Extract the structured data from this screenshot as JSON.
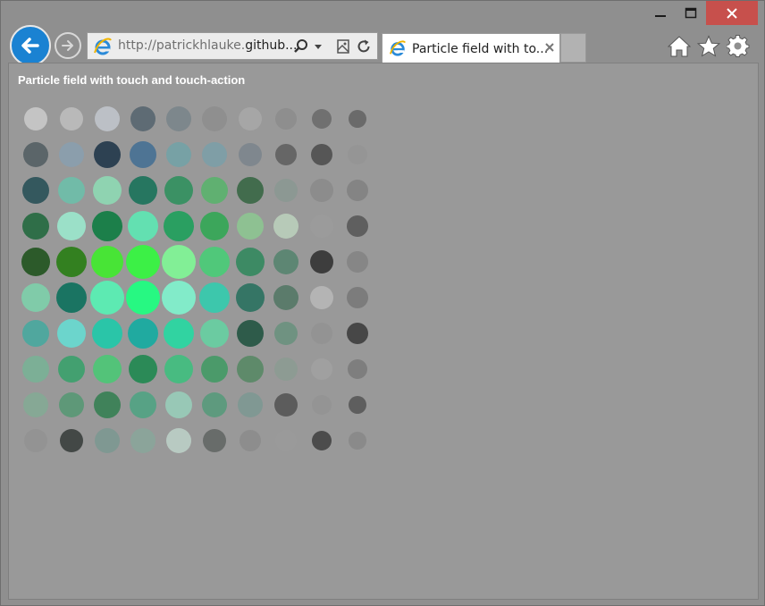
{
  "browser": {
    "address": {
      "url_prefix": "http://patrickhlauke.",
      "url_domain": "github..."
    },
    "tab": {
      "label": "Particle field with to..."
    }
  },
  "page": {
    "title": "Particle field with touch and touch-action"
  },
  "icons": [
    "back-arrow-icon",
    "forward-arrow-icon",
    "ie-logo-icon",
    "search-icon",
    "dropdown-icon",
    "compatibility-view-icon",
    "refresh-icon",
    "close-icon",
    "home-icon",
    "favorites-star-icon",
    "settings-gear-icon",
    "minimize-icon",
    "maximize-icon"
  ],
  "particles": {
    "rows": [
      [
        "#c4c4c4",
        "#b9b9b9",
        "#bcc0c6",
        "#5e6b74",
        "#7d878c",
        "#8f8f8f",
        "#a6a6a6",
        "#8e8e8e",
        "#707070",
        "#6a6a6a"
      ],
      [
        "#5b6569",
        "#8b9eac",
        "#2d4152",
        "#4e7494",
        "#77a1a5",
        "#7f9ea6",
        "#7f878e",
        "#666666",
        "#565656",
        "#959595"
      ],
      [
        "#34585e",
        "#71bba8",
        "#8fd3b1",
        "#267660",
        "#3b9164",
        "#60b071",
        "#426c4d",
        "#8c9893",
        "#8c8c8c",
        "#848484"
      ],
      [
        "#2f6e48",
        "#9be0c8",
        "#1c7f4a",
        "#63e0b1",
        "#2a9f61",
        "#3ca65b",
        "#8ec192",
        "#b7cab8",
        "#9b9b9b",
        "#5f5f5f"
      ],
      [
        "#2c5a2a",
        "#338020",
        "#48e436",
        "#3cf046",
        "#82ef96",
        "#50c87a",
        "#3d8a64",
        "#5d8673",
        "#3d3d3d",
        "#868686"
      ],
      [
        "#80cba9",
        "#1a7462",
        "#5deab2",
        "#27f882",
        "#82ebc9",
        "#3dc7ac",
        "#357565",
        "#5b7b6b",
        "#b4b4b4",
        "#7c7c7c"
      ],
      [
        "#50a79e",
        "#6cd5cc",
        "#2ac5a8",
        "#20aaa0",
        "#31d3a1",
        "#6bcba1",
        "#2e5b4a",
        "#6f9281",
        "#939393",
        "#474747"
      ],
      [
        "#7caf96",
        "#43a070",
        "#53c379",
        "#2b8a57",
        "#48bb81",
        "#4b9a6a",
        "#5e8a6a",
        "#8d9b93",
        "#a0a0a0",
        "#7e7e7e"
      ],
      [
        "#86a895",
        "#5e9878",
        "#40825a",
        "#57a285",
        "#98c8b6",
        "#5e9a7e",
        "#809893",
        "#5c5c5c",
        "#949494",
        "#5e5e5e"
      ],
      [
        "#939393",
        "#434846",
        "#7f9892",
        "#8ba49a",
        "#b8cac2",
        "#686c6a",
        "#8d8d8d",
        "#9a9a9a",
        "#4c4c4c",
        "#8a8a8a"
      ]
    ],
    "sizes": [
      [
        26,
        26,
        28,
        28,
        28,
        28,
        26,
        24,
        22,
        20
      ],
      [
        28,
        28,
        30,
        30,
        28,
        28,
        26,
        24,
        24,
        22
      ],
      [
        30,
        30,
        32,
        32,
        32,
        30,
        30,
        26,
        26,
        24
      ],
      [
        30,
        32,
        34,
        34,
        34,
        32,
        30,
        28,
        26,
        24
      ],
      [
        32,
        34,
        36,
        38,
        38,
        34,
        32,
        28,
        26,
        24
      ],
      [
        32,
        34,
        38,
        38,
        38,
        34,
        32,
        28,
        26,
        24
      ],
      [
        30,
        32,
        34,
        34,
        34,
        32,
        30,
        26,
        24,
        24
      ],
      [
        30,
        30,
        32,
        32,
        32,
        30,
        30,
        26,
        24,
        22
      ],
      [
        28,
        28,
        30,
        30,
        30,
        28,
        28,
        26,
        22,
        20
      ],
      [
        26,
        26,
        28,
        28,
        28,
        26,
        24,
        24,
        22,
        20
      ]
    ]
  }
}
